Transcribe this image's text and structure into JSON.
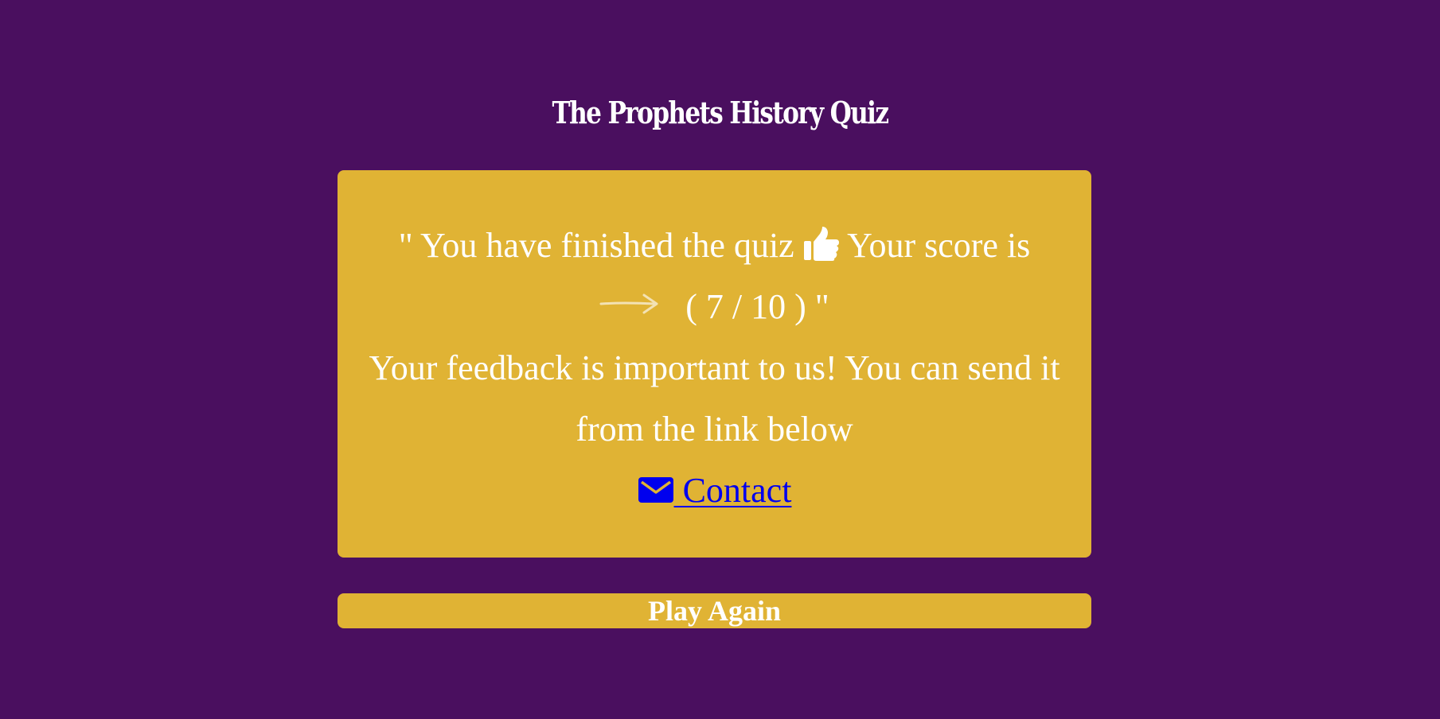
{
  "header": {
    "title": "The Prophets History Quiz"
  },
  "result": {
    "finished_prefix": "\" You have finished the quiz ",
    "score_label": " Your score is",
    "score_text": "( 7 / 10 ) \"",
    "feedback_line1": "Your feedback is important to us! You can send it",
    "feedback_line2": "from the link below",
    "contact_label": " Contact"
  },
  "actions": {
    "play_again_label": "Play Again"
  },
  "icons": {
    "thumb": "thumbs-up-icon",
    "arrow": "long-arrow-right-icon",
    "mail": "envelope-icon"
  },
  "colors": {
    "background": "#4a0f5f",
    "card": "#e0b334",
    "text": "#ffffff",
    "link": "#0000ee"
  }
}
